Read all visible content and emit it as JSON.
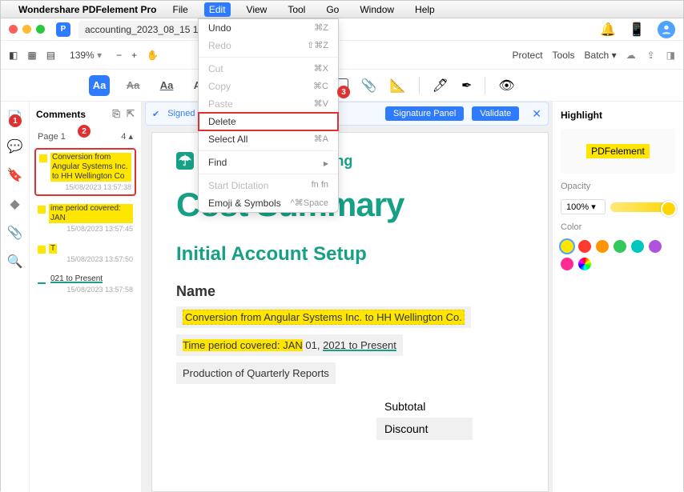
{
  "menubar": {
    "app_name": "Wondershare PDFelement Pro",
    "items": [
      "File",
      "Edit",
      "View",
      "Tool",
      "Go",
      "Window",
      "Help"
    ],
    "active": "Edit"
  },
  "edit_menu": {
    "undo": "Undo",
    "undo_sc": "⌘Z",
    "redo": "Redo",
    "redo_sc": "⇧⌘Z",
    "cut": "Cut",
    "cut_sc": "⌘X",
    "copy": "Copy",
    "copy_sc": "⌘C",
    "paste": "Paste",
    "paste_sc": "⌘V",
    "delete": "Delete",
    "select_all": "Select All",
    "select_all_sc": "⌘A",
    "find": "Find",
    "start_dict": "Start Dictation",
    "start_dict_sc": "fn fn",
    "emoji": "Emoji & Symbols",
    "emoji_sc": "^⌘Space"
  },
  "tab": {
    "name": "accounting_2023_08_15 1..."
  },
  "toolbar": {
    "zoom": "139%",
    "protect": "Protect",
    "tools": "Tools",
    "batch": "Batch"
  },
  "comments": {
    "title": "Comments",
    "page_label": "Page 1",
    "count": "4",
    "items": [
      {
        "text": "Conversion from Angular Systems Inc. to HH Wellington Co",
        "ts": "15/08/2023 13:57:38"
      },
      {
        "text": "ime period covered: JAN",
        "ts": "15/08/2023 13:57:45"
      },
      {
        "text": "T",
        "ts": "15/08/2023 13:57:50"
      },
      {
        "text": "021 to Present",
        "ts": "15/08/2023 13:57:58"
      }
    ]
  },
  "signbar": {
    "text": "Signed and ...",
    "panel": "Signature Panel",
    "validate": "Validate"
  },
  "doc": {
    "brand": "Umbrella Acccounting",
    "h1": "Cost Summary",
    "h2": "Initial Account Setup",
    "h3": "Name",
    "line1_a": "Conversion from Angular Systems Inc. to HH Wellington Co.",
    "line2_a": "Time period covered: JAN",
    "line2_b": " 01, ",
    "line2_c": "2021 to Present",
    "line3": "Production of Quarterly Reports",
    "subtotal": "Subtotal",
    "discount": "Discount"
  },
  "right": {
    "title": "Highlight",
    "sample": "PDFelement",
    "opacity_label": "Opacity",
    "opacity_value": "100%",
    "color_label": "Color",
    "colors": [
      "#ffe600",
      "#ff3b30",
      "#ff9500",
      "#34c759",
      "#00c7be",
      "#af52de",
      "#ff2d92"
    ]
  },
  "callouts": {
    "c1": "1",
    "c2": "2",
    "c3": "3"
  }
}
